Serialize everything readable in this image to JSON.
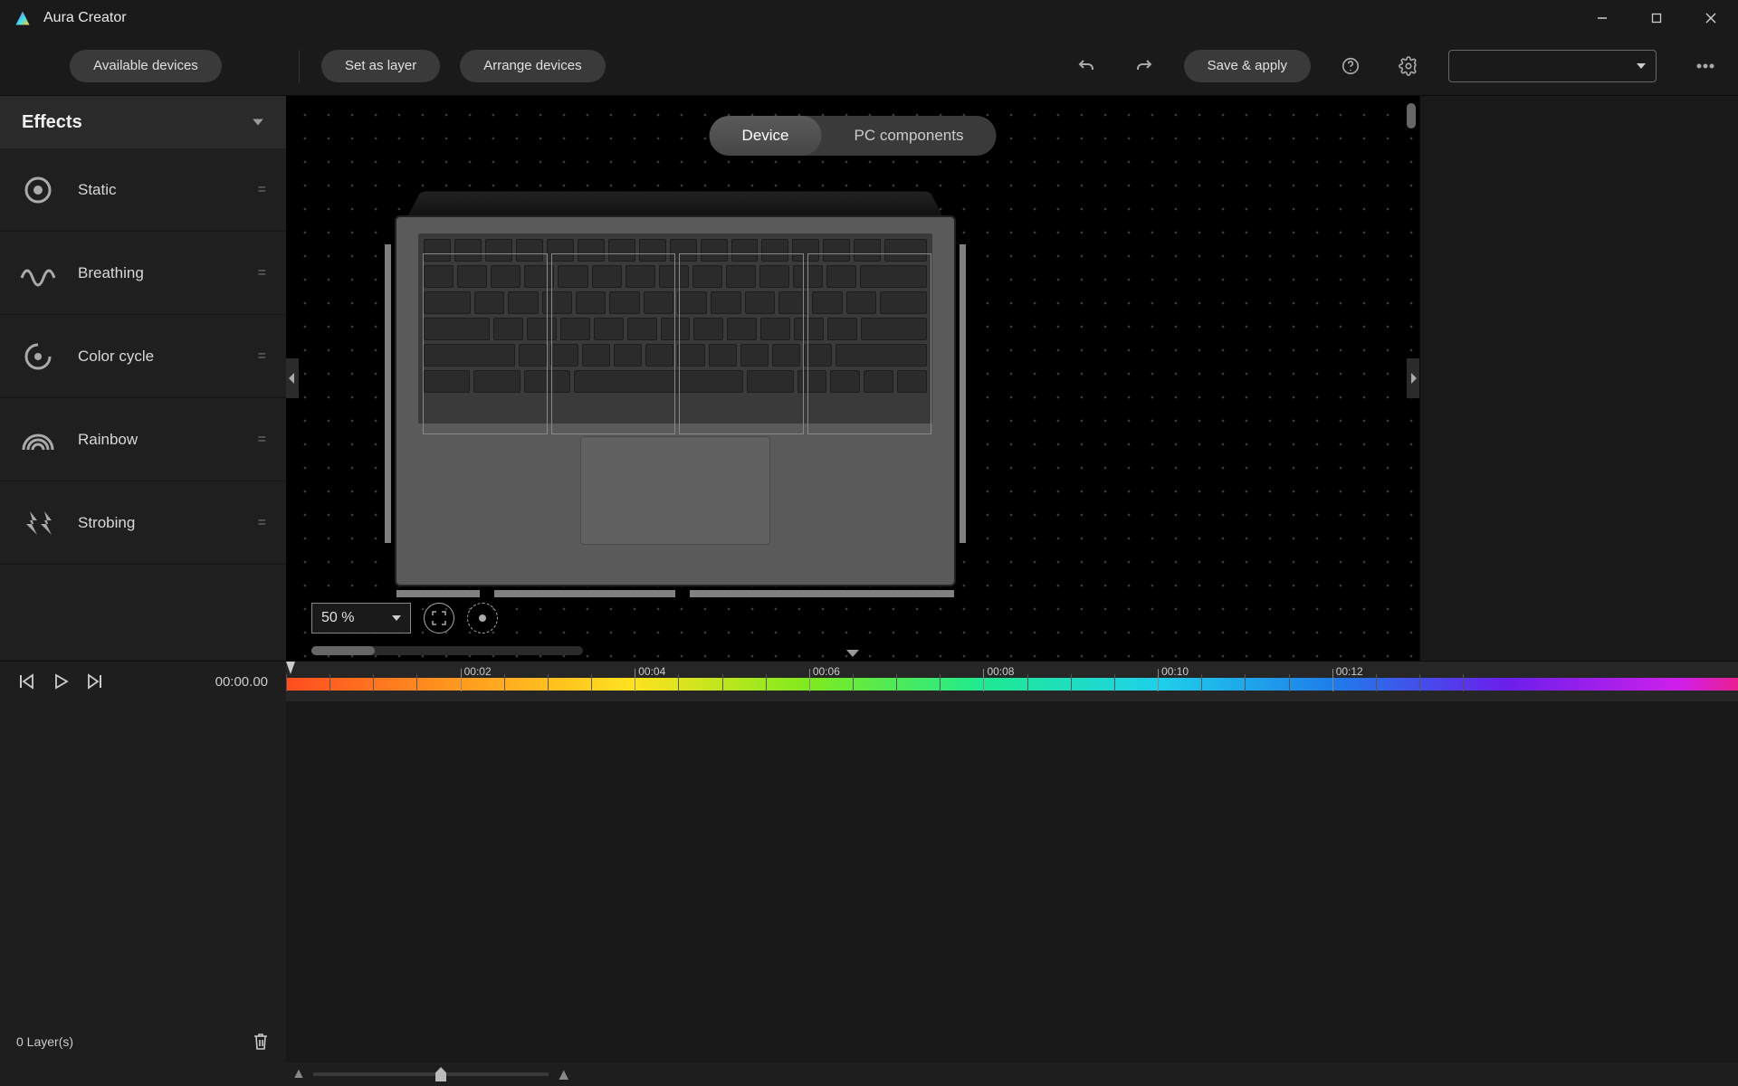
{
  "app": {
    "title": "Aura Creator"
  },
  "toolbar": {
    "available_devices": "Available devices",
    "set_as_layer": "Set as layer",
    "arrange_devices": "Arrange devices",
    "save_apply": "Save & apply"
  },
  "effects": {
    "header": "Effects",
    "items": [
      {
        "label": "Static"
      },
      {
        "label": "Breathing"
      },
      {
        "label": "Color cycle"
      },
      {
        "label": "Rainbow"
      },
      {
        "label": "Strobing"
      }
    ]
  },
  "view_tabs": {
    "device": "Device",
    "pc_components": "PC components"
  },
  "zoom": {
    "value": "50 %"
  },
  "timeline": {
    "current": "00:00.00",
    "ticks": [
      "00:02",
      "00:04",
      "00:06",
      "00:08",
      "00:10",
      "00:12"
    ],
    "layers_count": "0  Layer(s)"
  }
}
